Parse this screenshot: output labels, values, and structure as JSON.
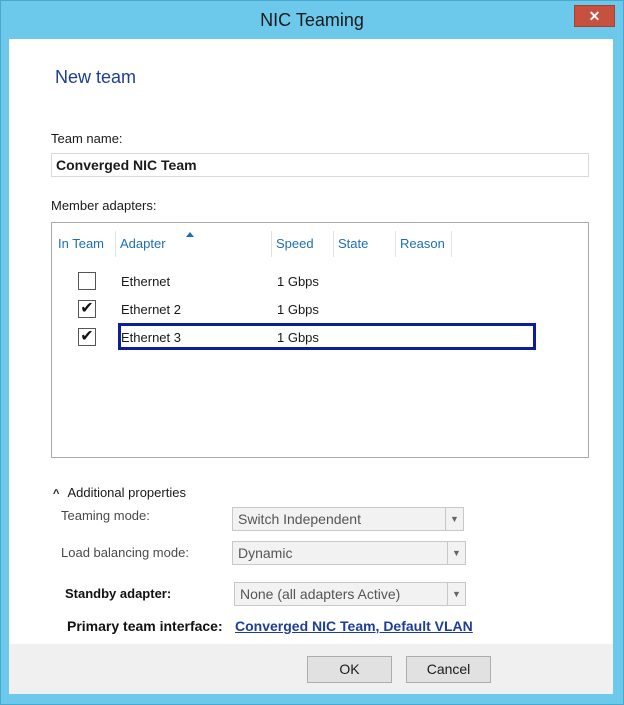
{
  "window": {
    "title": "NIC Teaming",
    "close_glyph": "✕"
  },
  "page_title": "New team",
  "team_name": {
    "label": "Team name:",
    "value": "Converged NIC Team"
  },
  "member_adapters": {
    "label": "Member adapters:",
    "columns": [
      "In Team",
      "Adapter",
      "Speed",
      "State",
      "Reason"
    ],
    "rows": [
      {
        "in_team": false,
        "check": "",
        "adapter": "Ethernet",
        "speed": "1 Gbps",
        "state": "",
        "reason": ""
      },
      {
        "in_team": true,
        "check": "✔",
        "adapter": "Ethernet 2",
        "speed": "1 Gbps",
        "state": "",
        "reason": ""
      },
      {
        "in_team": true,
        "check": "✔",
        "adapter": "Ethernet 3",
        "speed": "1 Gbps",
        "state": "",
        "reason": ""
      }
    ]
  },
  "additional_properties": {
    "toggle_label": "Additional properties",
    "teaming_mode": {
      "label": "Teaming mode:",
      "value": "Switch Independent"
    },
    "load_balancing_mode": {
      "label": "Load balancing mode:",
      "value": "Dynamic"
    },
    "standby_adapter": {
      "label": "Standby adapter:",
      "value": "None (all adapters Active)"
    },
    "primary_team_interface": {
      "label": "Primary team interface:",
      "link": "Converged NIC Team, Default VLAN"
    }
  },
  "buttons": {
    "ok": "OK",
    "cancel": "Cancel"
  },
  "colors": {
    "titlebar": "#6cc9ec",
    "accent_blue": "#1d3d99",
    "header_blue": "#1d6fb5",
    "selection_outline": "#0a1f99"
  }
}
